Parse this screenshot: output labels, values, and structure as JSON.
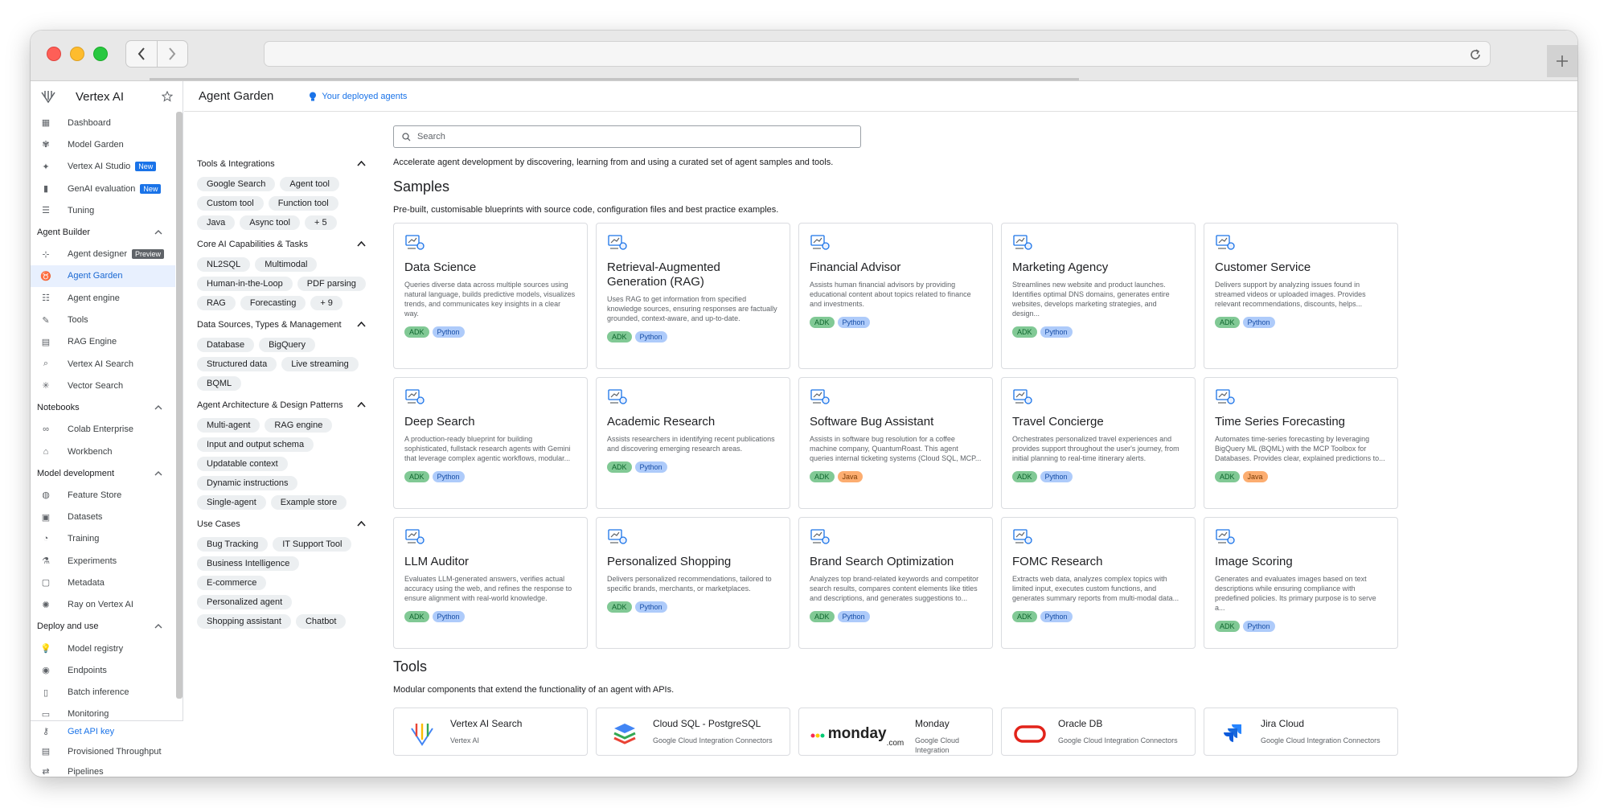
{
  "sidebar": {
    "product": "Vertex AI",
    "top_items": [
      {
        "label": "Dashboard",
        "icon": "dashboard-icon",
        "glyph": "▦"
      },
      {
        "label": "Model Garden",
        "icon": "model-garden-icon",
        "glyph": "✾"
      },
      {
        "label": "Vertex AI Studio",
        "icon": "studio-icon",
        "glyph": "✦",
        "badge": "New"
      },
      {
        "label": "GenAI evaluation",
        "icon": "evaluation-icon",
        "glyph": "▮",
        "badge": "New"
      },
      {
        "label": "Tuning",
        "icon": "tuning-icon",
        "glyph": "☰"
      }
    ],
    "sections": [
      {
        "title": "Agent Builder",
        "items": [
          {
            "label": "Agent designer",
            "icon": "agent-designer-icon",
            "glyph": "⊹",
            "badge": "Preview"
          },
          {
            "label": "Agent Garden",
            "icon": "agent-garden-icon",
            "glyph": "♉",
            "active": true
          },
          {
            "label": "Agent engine",
            "icon": "agent-engine-icon",
            "glyph": "☷"
          },
          {
            "label": "Tools",
            "icon": "tools-icon",
            "glyph": "✎"
          },
          {
            "label": "RAG Engine",
            "icon": "rag-engine-icon",
            "glyph": "▤"
          },
          {
            "label": "Vertex AI Search",
            "icon": "search-icon",
            "glyph": "⌕"
          },
          {
            "label": "Vector Search",
            "icon": "vector-search-icon",
            "glyph": "✳"
          }
        ]
      },
      {
        "title": "Notebooks",
        "items": [
          {
            "label": "Colab Enterprise",
            "icon": "colab-icon",
            "glyph": "∞"
          },
          {
            "label": "Workbench",
            "icon": "workbench-icon",
            "glyph": "⌂"
          }
        ]
      },
      {
        "title": "Model development",
        "items": [
          {
            "label": "Feature Store",
            "icon": "feature-store-icon",
            "glyph": "◍"
          },
          {
            "label": "Datasets",
            "icon": "datasets-icon",
            "glyph": "▣"
          },
          {
            "label": "Training",
            "icon": "training-icon",
            "glyph": "◔"
          },
          {
            "label": "Experiments",
            "icon": "experiments-icon",
            "glyph": "⚗"
          },
          {
            "label": "Metadata",
            "icon": "metadata-icon",
            "glyph": "▢"
          },
          {
            "label": "Ray on Vertex AI",
            "icon": "ray-icon",
            "glyph": "✺"
          }
        ]
      },
      {
        "title": "Deploy and use",
        "items": [
          {
            "label": "Model registry",
            "icon": "model-registry-icon",
            "glyph": "💡"
          },
          {
            "label": "Endpoints",
            "icon": "endpoints-icon",
            "glyph": "◉"
          },
          {
            "label": "Batch inference",
            "icon": "batch-inference-icon",
            "glyph": "▯"
          },
          {
            "label": "Monitoring",
            "icon": "monitoring-icon",
            "glyph": "▭"
          }
        ]
      }
    ],
    "bottom_items": [
      {
        "label": "Get API key",
        "icon": "key-icon",
        "glyph": "⚷"
      },
      {
        "label": "Provisioned Throughput",
        "icon": "throughput-icon",
        "glyph": "▤"
      },
      {
        "label": "Pipelines",
        "icon": "pipelines-icon",
        "glyph": "⇄"
      }
    ]
  },
  "header": {
    "page_title": "Agent Garden",
    "deployed_link": "Your deployed agents"
  },
  "filters": [
    {
      "title": "Tools & Integrations",
      "chips": [
        "Google Search",
        "Agent tool",
        "Custom tool",
        "Function tool",
        "Java",
        "Async tool",
        "+ 5"
      ]
    },
    {
      "title": "Core AI Capabilities & Tasks",
      "chips": [
        "NL2SQL",
        "Multimodal",
        "Human-in-the-Loop",
        "PDF parsing",
        "RAG",
        "Forecasting",
        "+ 9"
      ]
    },
    {
      "title": "Data Sources, Types & Management",
      "chips": [
        "Database",
        "BigQuery",
        "Structured data",
        "Live streaming",
        "BQML"
      ]
    },
    {
      "title": "Agent Architecture & Design Patterns",
      "chips": [
        "Multi-agent",
        "RAG engine",
        "Input and output schema",
        "Updatable context",
        "Dynamic instructions",
        "Single-agent",
        "Example store"
      ]
    },
    {
      "title": "Use Cases",
      "chips": [
        "Bug Tracking",
        "IT Support Tool",
        "Business Intelligence",
        "E-commerce",
        "Personalized agent",
        "Shopping assistant",
        "Chatbot"
      ]
    }
  ],
  "main": {
    "search_placeholder": "Search",
    "intro": "Accelerate agent development by discovering, learning from and using a curated set of agent samples and tools.",
    "samples_title": "Samples",
    "samples_sub": "Pre-built, customisable blueprints with source code, configuration files and best practice examples.",
    "samples": [
      {
        "title": "Data Science",
        "desc": "Queries diverse data across multiple sources using natural language, builds predictive models, visualizes trends, and communicates key insights in a clear way.",
        "tags": [
          "ADK",
          "Python"
        ],
        "icon": "data-science-icon"
      },
      {
        "title": "Retrieval-Augmented Generation (RAG)",
        "desc": "Uses RAG to get information from specified knowledge sources, ensuring responses are factually grounded, context-aware, and up-to-date.",
        "tags": [
          "ADK",
          "Python"
        ],
        "icon": "rag-icon"
      },
      {
        "title": "Financial Advisor",
        "desc": "Assists human financial advisors by providing educational content about topics related to finance and investments.",
        "tags": [
          "ADK",
          "Python"
        ],
        "icon": "financial-advisor-icon"
      },
      {
        "title": "Marketing Agency",
        "desc": "Streamlines new website and product launches. Identifies optimal DNS domains, generates entire websites, develops marketing strategies, and design...",
        "tags": [
          "ADK",
          "Python"
        ],
        "icon": "marketing-agency-icon"
      },
      {
        "title": "Customer Service",
        "desc": "Delivers support by analyzing issues found in streamed videos or uploaded images. Provides relevant recommendations, discounts, helps...",
        "tags": [
          "ADK",
          "Python"
        ],
        "icon": "customer-service-icon"
      },
      {
        "title": "Deep Search",
        "desc": "A production-ready blueprint for building sophisticated, fullstack research agents with Gemini that leverage complex agentic workflows, modular...",
        "tags": [
          "ADK",
          "Python"
        ],
        "icon": "deep-search-icon"
      },
      {
        "title": "Academic Research",
        "desc": "Assists researchers in identifying recent publications and discovering emerging research areas.",
        "tags": [
          "ADK",
          "Python"
        ],
        "icon": "academic-research-icon"
      },
      {
        "title": "Software Bug Assistant",
        "desc": "Assists in software bug resolution for a coffee machine company, QuantumRoast. This agent queries internal ticketing systems (Cloud SQL, MCP...",
        "tags": [
          "ADK",
          "Java"
        ],
        "icon": "bug-assistant-icon"
      },
      {
        "title": "Travel Concierge",
        "desc": "Orchestrates personalized travel experiences and provides support throughout the user's journey, from initial planning to real-time itinerary alerts.",
        "tags": [
          "ADK",
          "Python"
        ],
        "icon": "travel-concierge-icon"
      },
      {
        "title": "Time Series Forecasting",
        "desc": "Automates time-series forecasting by leveraging BigQuery ML (BQML) with the MCP Toolbox for Databases. Provides clear, explained predictions to...",
        "tags": [
          "ADK",
          "Java"
        ],
        "icon": "forecasting-icon"
      },
      {
        "title": "LLM Auditor",
        "desc": "Evaluates LLM-generated answers, verifies actual accuracy using the web, and refines the response to ensure alignment with real-world knowledge.",
        "tags": [
          "ADK",
          "Python"
        ],
        "icon": "llm-auditor-icon"
      },
      {
        "title": "Personalized Shopping",
        "desc": "Delivers personalized recommendations, tailored to specific brands, merchants, or marketplaces.",
        "tags": [
          "ADK",
          "Python"
        ],
        "icon": "shopping-icon"
      },
      {
        "title": "Brand Search Optimization",
        "desc": "Analyzes top brand-related keywords and competitor search results, compares content elements like titles and descriptions, and generates suggestions to...",
        "tags": [
          "ADK",
          "Python"
        ],
        "icon": "brand-search-icon"
      },
      {
        "title": "FOMC Research",
        "desc": "Extracts web data, analyzes complex topics with limited input, executes custom functions, and generates summary reports from multi-modal data...",
        "tags": [
          "ADK",
          "Python"
        ],
        "icon": "fomc-research-icon"
      },
      {
        "title": "Image Scoring",
        "desc": "Generates and evaluates images based on text descriptions while ensuring compliance with predefined policies. Its primary purpose is to serve a...",
        "tags": [
          "ADK",
          "Python"
        ],
        "icon": "image-scoring-icon"
      }
    ],
    "tools_title": "Tools",
    "tools_sub": "Modular components that extend the functionality of an agent with APIs.",
    "tools": [
      {
        "name": "Vertex AI Search",
        "source": "Vertex AI",
        "logo": "vertex-ai-search-logo"
      },
      {
        "name": "Cloud SQL - PostgreSQL",
        "source": "Google Cloud Integration Connectors",
        "logo": "cloud-sql-logo"
      },
      {
        "name": "Monday",
        "source": "Google Cloud Integration",
        "logo": "monday-logo",
        "logo_text": "monday",
        "logo_suffix": ".com"
      },
      {
        "name": "Oracle DB",
        "source": "Google Cloud Integration Connectors",
        "logo": "oracle-logo"
      },
      {
        "name": "Jira Cloud",
        "source": "Google Cloud Integration Connectors",
        "logo": "jira-logo"
      }
    ]
  },
  "colors": {
    "accent": "#1a73e8",
    "adk": "#81c995",
    "python": "#aecbfa",
    "java": "#fcad70"
  }
}
